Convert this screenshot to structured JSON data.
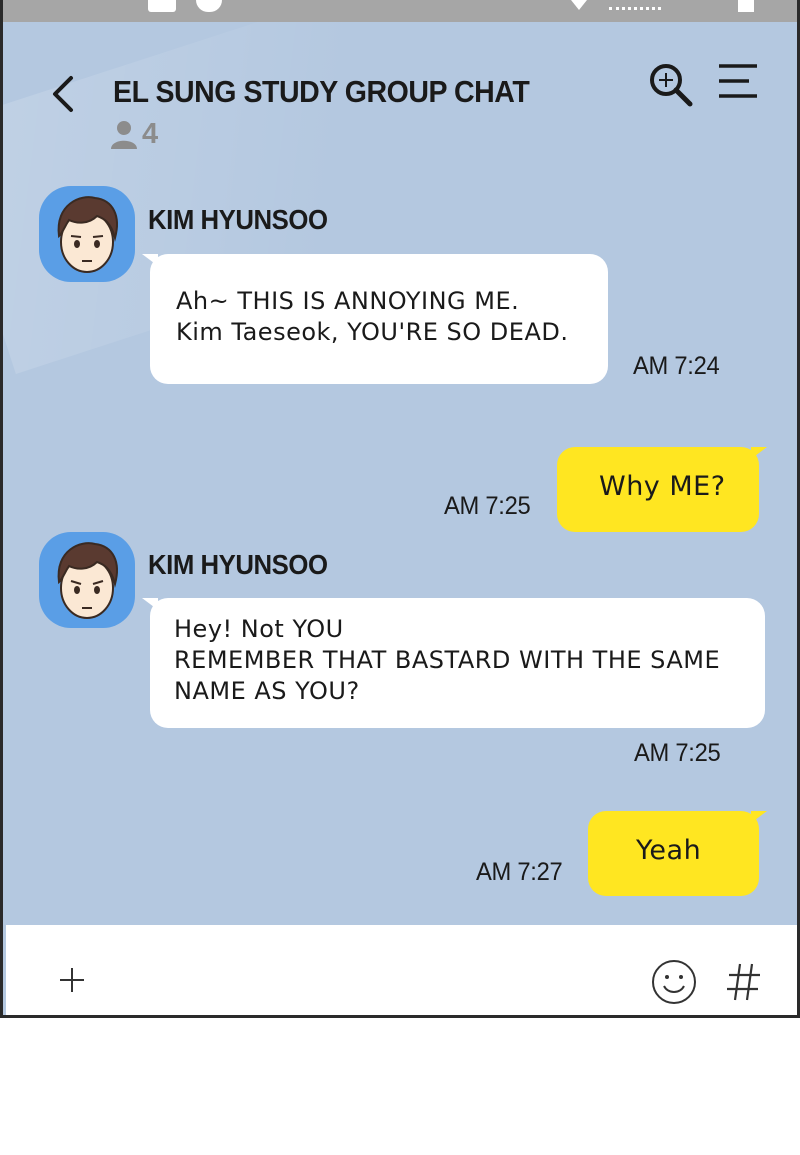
{
  "header": {
    "title": "EL SUNG STUDY GROUP CHAT",
    "member_count": "4",
    "icons": {
      "back": "chevron-left-icon",
      "members": "person-icon",
      "search": "search-icon",
      "menu": "hamburger-menu-icon"
    }
  },
  "messages": [
    {
      "side": "left",
      "sender": "KIM HYUNSOO",
      "lines": [
        "Ah~ THIS IS ANNOYING ME.",
        "Kim Taeseok, YOU'RE SO DEAD."
      ],
      "time": "AM 7:24"
    },
    {
      "side": "right",
      "lines": [
        "Why ME?"
      ],
      "time": "AM 7:25"
    },
    {
      "side": "left",
      "sender": "KIM HYUNSOO",
      "lines": [
        "Hey! Not YOU",
        "REMEMBER THAT BASTARD WITH THE SAME",
        "NAME AS YOU?"
      ],
      "time": "AM 7:25"
    },
    {
      "side": "right",
      "lines": [
        "Yeah"
      ],
      "time": "AM 7:27"
    }
  ],
  "input_bar": {
    "icons": {
      "plus": "plus-icon",
      "emoji": "smiley-icon",
      "hashtag": "hashtag-icon"
    }
  },
  "colors": {
    "chat_background": "#b4c8e0",
    "outgoing_bubble": "#ffe621",
    "incoming_bubble": "#ffffff",
    "avatar_background": "#5a9ee6",
    "status_bar": "#a6a6a6"
  }
}
